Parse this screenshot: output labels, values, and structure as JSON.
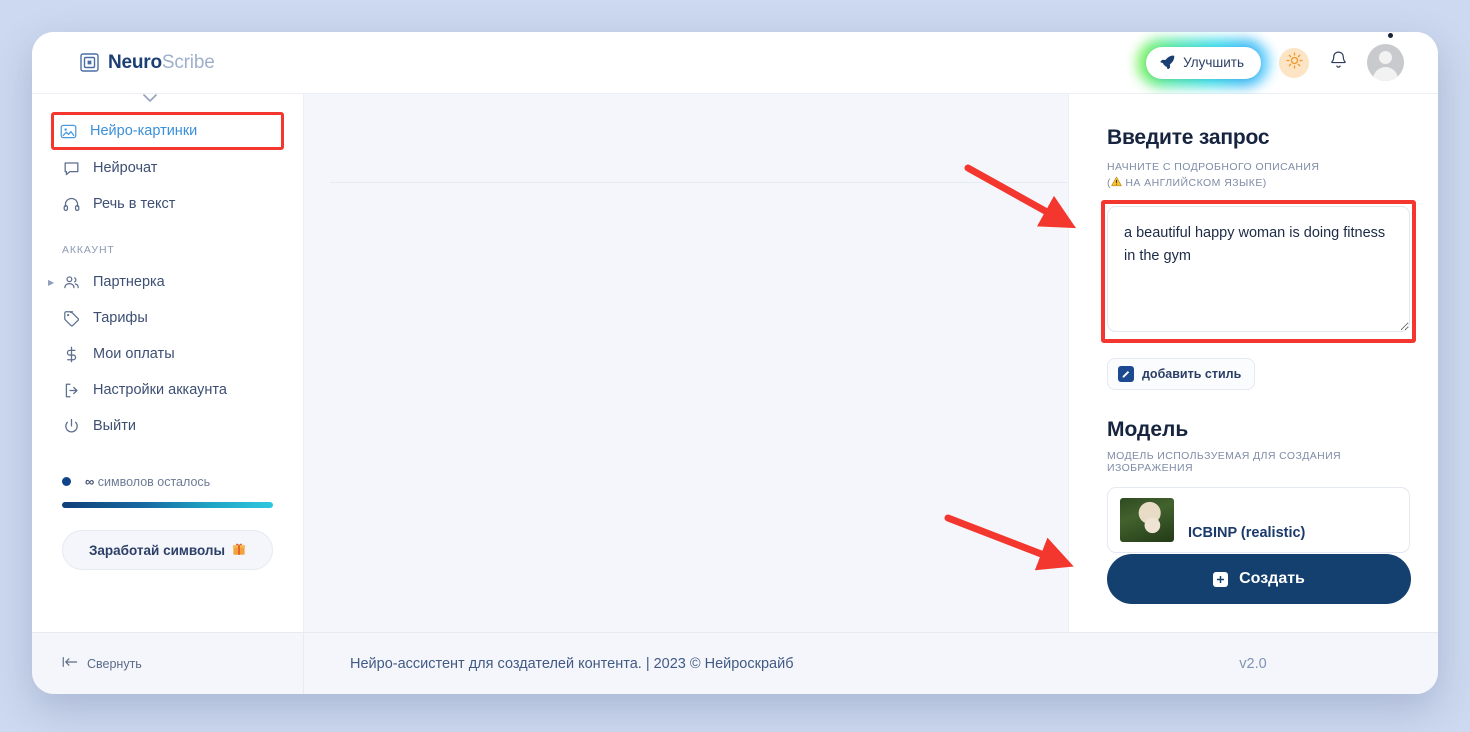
{
  "brand": {
    "bold": "Neuro",
    "light": "Scribe",
    "logo_icon": "nested-squares-logo-icon"
  },
  "topbar": {
    "upgrade_label": "Улучшить",
    "upgrade_icon": "rocket-icon",
    "theme_icon": "sun-icon",
    "notifications_icon": "bell-icon",
    "avatar_icon": "user-avatar-icon"
  },
  "sidebar": {
    "items": [
      {
        "label": "Нейро-картинки",
        "icon": "image-icon",
        "active": true,
        "highlighted": true
      },
      {
        "label": "Нейрочат",
        "icon": "chat-bubble-icon",
        "active": false,
        "highlighted": false
      },
      {
        "label": "Речь в текст",
        "icon": "headphones-icon",
        "active": false,
        "highlighted": false
      }
    ],
    "section_label": "АККАУНТ",
    "account_items": [
      {
        "label": "Партнерка",
        "icon": "users-icon",
        "expandable": true
      },
      {
        "label": "Тарифы",
        "icon": "tag-icon",
        "expandable": false
      },
      {
        "label": "Мои оплаты",
        "icon": "dollar-icon",
        "expandable": false
      },
      {
        "label": "Настройки аккаунта",
        "icon": "login-arrow-icon",
        "expandable": false
      },
      {
        "label": "Выйти",
        "icon": "power-icon",
        "expandable": false
      }
    ],
    "quota": {
      "amount": "∞",
      "text": "символов осталось",
      "bar_from": "#0f3f78",
      "bar_to": "#2ec8df",
      "earn_label": "Заработай символы",
      "earn_icon": "gift-icon"
    }
  },
  "right_panel": {
    "prompt_title": "Введите запрос",
    "prompt_sub_line1": "НАЧНИТЕ С ПОДРОБНОГО ОПИСАНИЯ",
    "prompt_sub_line2_pre": "(",
    "prompt_sub_line2_post": " НА АНГЛИЙСКОМ ЯЗЫКЕ)",
    "prompt_sub_icon": "warning-triangle-icon",
    "prompt_value": "a beautiful happy woman is doing fitness in the gym",
    "prompt_placeholder": "",
    "style_button_label": "добавить стиль",
    "style_button_icon": "pencil-square-icon",
    "model_title": "Модель",
    "model_sub": "МОДЕЛЬ ИСПОЛЬЗУЕМАЯ ДЛЯ СОЗДАНИЯ ИЗОБРАЖЕНИЯ",
    "model_name": "ICBINP (realistic)",
    "model_thumb_icon": "model-preview-thumbnail",
    "create_label": "Создать",
    "create_icon": "plus-square-icon"
  },
  "footer": {
    "collapse_label": "Свернуть",
    "collapse_icon": "collapse-left-icon",
    "center_text": "Нейро-ассистент для создателей контента.  | 2023 © Нейроскрайб",
    "version": "v2.0"
  },
  "annotations": {
    "accent_color": "#f4372e",
    "arrow_count": 2
  }
}
